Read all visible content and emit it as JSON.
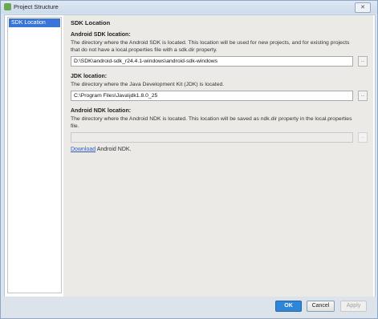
{
  "window": {
    "title": "Project Structure",
    "close_glyph": "✕"
  },
  "sidebar": {
    "items": [
      {
        "label": "SDK Location",
        "selected": true
      }
    ]
  },
  "main": {
    "heading": "SDK Location",
    "android_sdk": {
      "label": "Android SDK location:",
      "description": "The directory where the Android SDK is located. This location will be used for new projects, and for existing projects that do not have a local.properties file with a sdk.dir property.",
      "value": "D:\\SDK\\android-sdk_r24.4.1-windows\\android-sdk-windows",
      "browse_label": "..."
    },
    "jdk": {
      "label": "JDK location:",
      "description": "The directory where the Java Development Kit (JDK) is located.",
      "value": "C:\\Program Files\\Java\\jdk1.8.0_25",
      "browse_label": "..."
    },
    "android_ndk": {
      "label": "Android NDK location:",
      "description": "The directory where the Android NDK is located. This location will be saved as ndk.dir property in the local.properties file.",
      "value": "",
      "browse_label": "...",
      "download_link": "Download",
      "download_suffix": " Android NDK."
    }
  },
  "footer": {
    "ok_label": "OK",
    "cancel_label": "Cancel",
    "apply_label": "Apply"
  },
  "colors": {
    "selection": "#3875d7",
    "link": "#2e59c4",
    "primary_button": "#2f86d6"
  }
}
